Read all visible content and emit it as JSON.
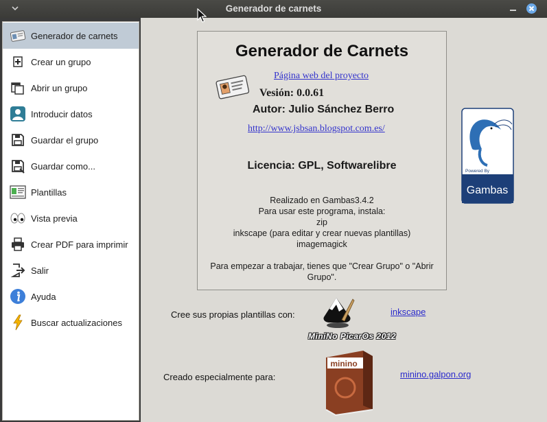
{
  "window": {
    "title": "Generador de carnets"
  },
  "sidebar": {
    "items": [
      {
        "label": "Generador de carnets",
        "icon": "id-card-icon"
      },
      {
        "label": "Crear un grupo",
        "icon": "add-group-icon"
      },
      {
        "label": "Abrir un grupo",
        "icon": "open-group-icon"
      },
      {
        "label": "Introducir datos",
        "icon": "user-icon"
      },
      {
        "label": "Guardar el grupo",
        "icon": "floppy-icon"
      },
      {
        "label": "Guardar como...",
        "icon": "floppy-save-as-icon"
      },
      {
        "label": "Plantillas",
        "icon": "template-icon"
      },
      {
        "label": "Vista previa",
        "icon": "eyes-icon"
      },
      {
        "label": "Crear PDF para imprimir",
        "icon": "printer-icon"
      },
      {
        "label": "Salir",
        "icon": "exit-icon"
      },
      {
        "label": "Ayuda",
        "icon": "info-icon"
      },
      {
        "label": "Buscar actualizaciones",
        "icon": "lightning-icon"
      }
    ]
  },
  "about": {
    "heading": "Generador de Carnets",
    "project_link": "Página web del proyecto",
    "version": "Vesión: 0.0.61",
    "author": "Autor: Julio Sánchez Berro",
    "blog_link": "http://www.jsbsan.blogspot.com.es/",
    "license": "Licencia: GPL, Softwarelibre",
    "info_lines": [
      "Realizado en Gambas3.4.2",
      "Para usar este programa, instala:",
      "zip",
      "inkscape (para editar y crear nuevas plantillas)",
      "imagemagick"
    ],
    "start_text": "Para empezar a trabajar, tienes que \"Crear Grupo\" o \"Abrir Grupo\"."
  },
  "gambas_logo": {
    "powered_by": "Powered By",
    "name": "Gambas"
  },
  "templates_row": {
    "label": "Cree sus propias plantillas con:",
    "link": "inkscape",
    "badge": "MiniNo PicarOs 2012"
  },
  "minino_row": {
    "label": "Creado especialmente para:",
    "link": "minino.galpon.org",
    "box_text": "minino"
  },
  "colors": {
    "sidebar_active": "#c0cbd6",
    "link": "#3333cc",
    "gambas_blue": "#1d3f78"
  }
}
